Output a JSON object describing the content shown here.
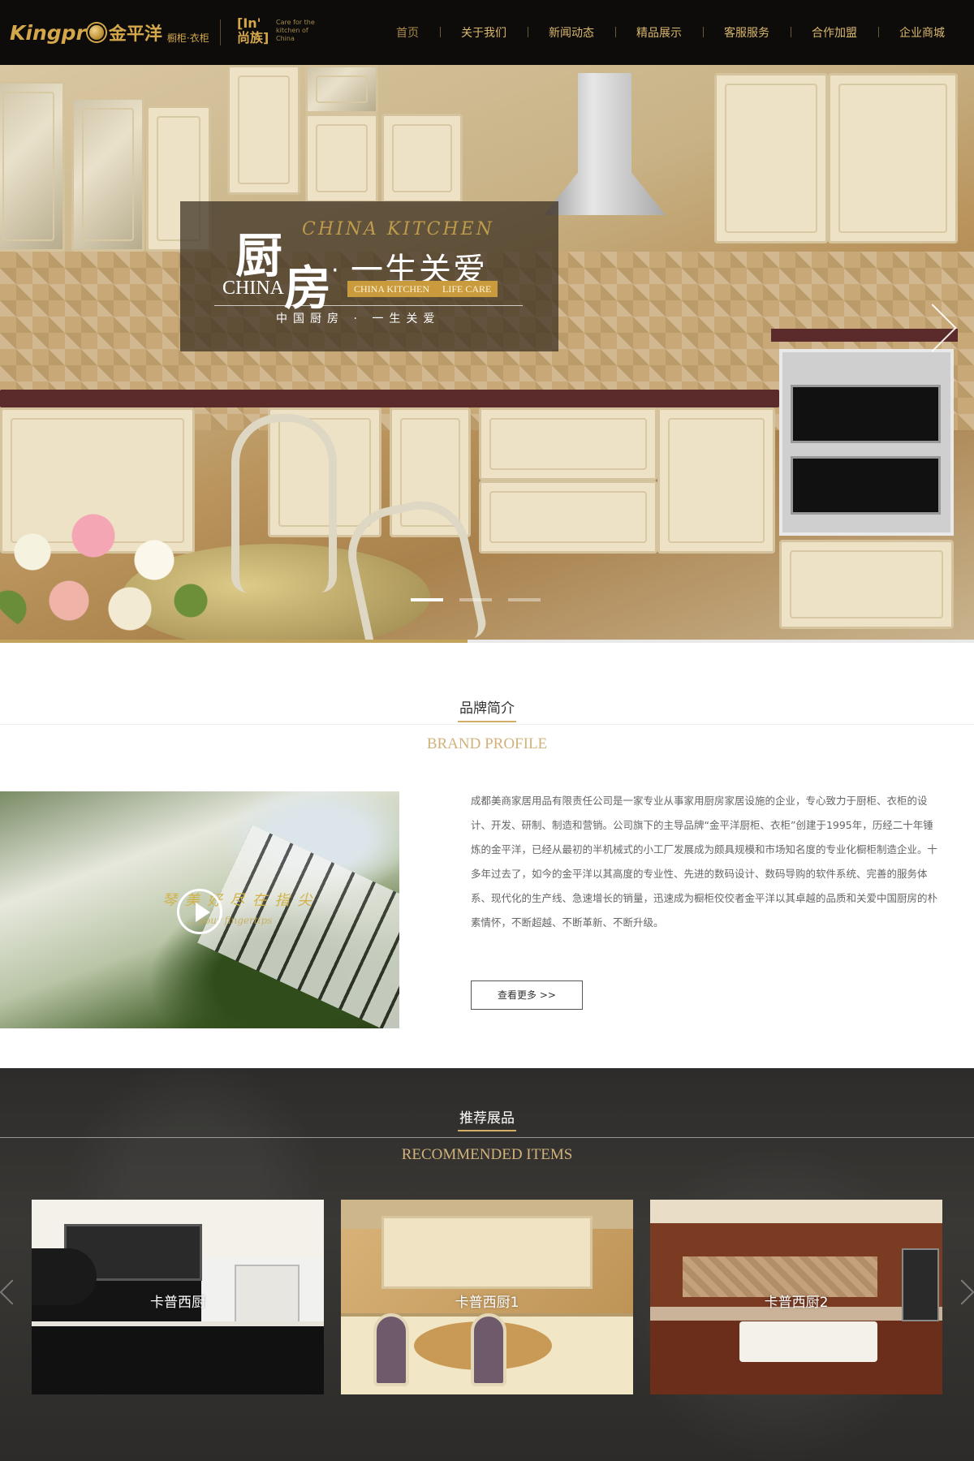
{
  "header": {
    "logo_latin": "Kingpr",
    "logo_cn": "金平洋",
    "logo_tagline": "橱柜·衣柜",
    "sub_logo_mark": "[In' 尚族]",
    "sub_logo_text": "Care for the kitchen of China",
    "nav": [
      {
        "label": "首页",
        "active": true
      },
      {
        "label": "关于我们",
        "active": false
      },
      {
        "label": "新闻动态",
        "active": false
      },
      {
        "label": "精品展示",
        "active": false
      },
      {
        "label": "客服服务",
        "active": false
      },
      {
        "label": "合作加盟",
        "active": false
      },
      {
        "label": "企业商城",
        "active": false
      }
    ]
  },
  "hero": {
    "script_text": "CHINA KITCHEN",
    "char1": "厨",
    "char2": "房",
    "dot": "·",
    "china": "CHINA",
    "title": "一生关爱",
    "tag1": "CHINA KITCHEN",
    "tag2": "LIFE CARE",
    "subtitle": "中国厨房 · 一生关爱",
    "slides_total": 3,
    "slide_active": 1,
    "progress_fraction": 0.48
  },
  "brand": {
    "title_cn": "品牌简介",
    "title_en": "BRAND PROFILE",
    "video_script_cn": "琴 美 好 尽 在 指 尖",
    "video_script_en": "... your fingertips",
    "description": "成都美商家居用品有限责任公司是一家专业从事家用厨房家居设施的企业，专心致力于厨柜、衣柜的设计、开发、研制、制造和营销。公司旗下的主导品牌“金平洋厨柜、衣柜”创建于1995年，历经二十年锤炼的金平洋，已经从最初的半机械式的小工厂发展成为颇具规模和市场知名度的专业化橱柜制造企业。十多年过去了，如今的金平洋以其高度的专业性、先进的数码设计、数码导购的软件系统、完善的服务体系、现代化的生产线、急速增长的销量，迅速成为橱柜佼佼者金平洋以其卓越的品质和关爱中国厨房的朴素情怀，不断超越、不断革新、不断升级。",
    "more_label": "查看更多 >>"
  },
  "recommended": {
    "title_cn": "推荐展品",
    "title_en": "RECOMMENDED ITEMS",
    "items": [
      {
        "label": "卡普西厨"
      },
      {
        "label": "卡普西厨1"
      },
      {
        "label": "卡普西厨2"
      }
    ]
  },
  "colors": {
    "header_bg": "#0d0c0a",
    "gold": "#d4a84a",
    "accent_gold": "#d1b27a",
    "dark_section": "#33312e"
  }
}
